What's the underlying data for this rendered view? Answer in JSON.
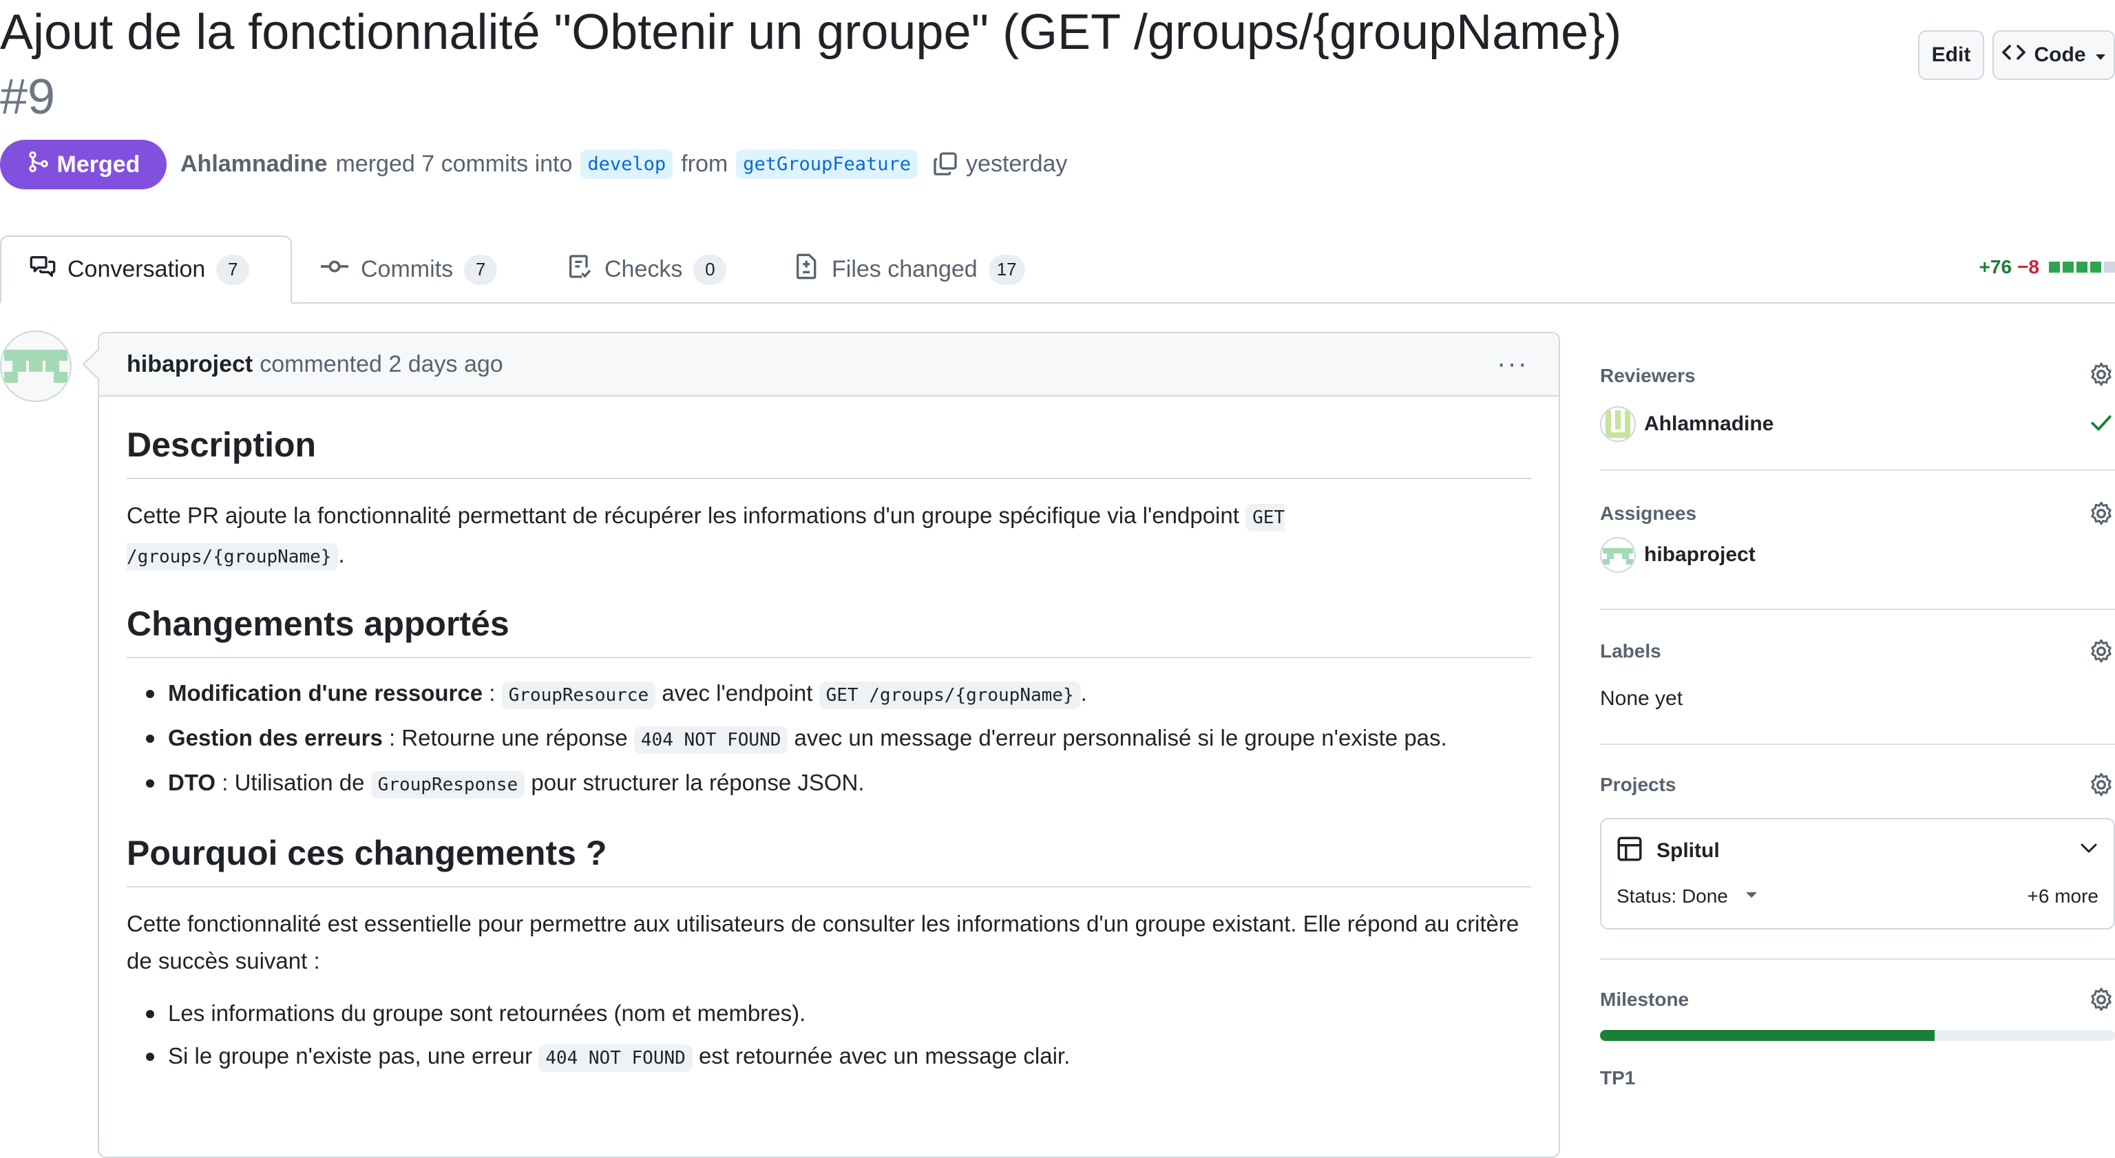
{
  "pr": {
    "title": "Ajout de la fonctionnalité \"Obtenir un groupe\" (GET /groups/{groupName})",
    "number": "#9",
    "state": "Merged",
    "author": "Ahlamnadine",
    "action": "merged 7 commits into",
    "base_branch": "develop",
    "from_text": "from",
    "head_branch": "getGroupFeature",
    "time": "yesterday"
  },
  "header_buttons": {
    "edit": "Edit",
    "code": "Code"
  },
  "tabs": [
    {
      "label": "Conversation",
      "count": "7",
      "icon": "comment-discussion-icon"
    },
    {
      "label": "Commits",
      "count": "7",
      "icon": "git-commit-icon"
    },
    {
      "label": "Checks",
      "count": "0",
      "icon": "checklist-icon"
    },
    {
      "label": "Files changed",
      "count": "17",
      "icon": "file-diff-icon"
    }
  ],
  "diffstat": {
    "additions": "+76",
    "deletions": "−8",
    "blocks_green": 4,
    "blocks_total": 5
  },
  "comment": {
    "author": "hibaproject",
    "meta": "commented 2 days ago",
    "menu": "···",
    "description_heading": "Description",
    "description_text": "Cette PR ajoute la fonctionnalité permettant de récupérer les informations d'un groupe spécifique via l'endpoint",
    "description_code": "GET /groups/{groupName}",
    "description_end": ".",
    "changes_heading": "Changements apportés",
    "changes": [
      {
        "bold": "Modification d'une ressource",
        "sep": " : ",
        "code1": "GroupResource",
        "mid": " avec l'endpoint ",
        "code2": "GET /groups/{groupName}",
        "end": "."
      },
      {
        "bold": "Gestion des erreurs",
        "sep": " : Retourne une réponse ",
        "code1": "404 NOT FOUND",
        "mid": " avec un message d'erreur personnalisé si le groupe n'existe pas.",
        "code2": "",
        "end": ""
      },
      {
        "bold": "DTO",
        "sep": " : Utilisation de ",
        "code1": "GroupResponse",
        "mid": " pour structurer la réponse JSON.",
        "code2": "",
        "end": ""
      }
    ],
    "why_heading": "Pourquoi ces changements ?",
    "why_text": "Cette fonctionnalité est essentielle pour permettre aux utilisateurs de consulter les informations d'un groupe existant. Elle répond au critère de succès suivant :",
    "criteria": [
      {
        "text": "Les informations du groupe sont retournées (nom et membres).",
        "code": "",
        "after": ""
      },
      {
        "text": "Si le groupe n'existe pas, une erreur ",
        "code": "404 NOT FOUND",
        "after": " est retournée avec un message clair."
      }
    ]
  },
  "sidebar": {
    "reviewers_label": "Reviewers",
    "reviewer": "Ahlamnadine",
    "assignees_label": "Assignees",
    "assignee": "hibaproject",
    "labels_label": "Labels",
    "labels_value": "None yet",
    "projects_label": "Projects",
    "project_name": "Splitul",
    "project_status": "Status: Done",
    "project_more": "+6 more",
    "milestone_label": "Milestone",
    "milestone_name": "TP1",
    "milestone_progress": 0.65
  },
  "colors": {
    "merged": "#8250df",
    "link": "#0969da",
    "add": "#1a7f37",
    "del": "#cf222e"
  }
}
